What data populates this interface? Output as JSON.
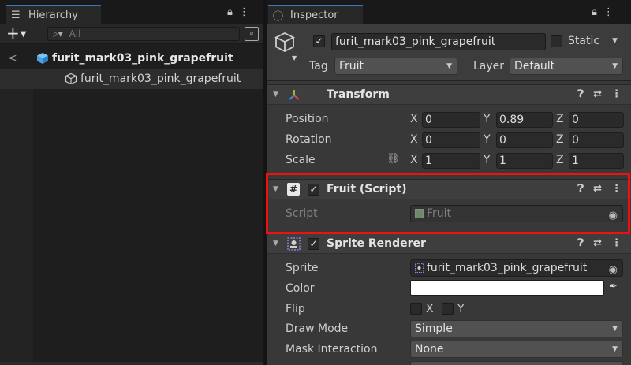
{
  "hierarchy": {
    "tab_label": "Hierarchy",
    "search_placeholder": "All",
    "scene_name": "furit_mark03_pink_grapefruit",
    "child_name": "furit_mark03_pink_grapefruit"
  },
  "inspector": {
    "tab_label": "Inspector",
    "object_name": "furit_mark03_pink_grapefruit",
    "active": true,
    "static_label": "Static",
    "tag_label": "Tag",
    "tag_value": "Fruit",
    "layer_label": "Layer",
    "layer_value": "Default",
    "transform": {
      "title": "Transform",
      "position_label": "Position",
      "rotation_label": "Rotation",
      "scale_label": "Scale",
      "position": {
        "x": "0",
        "y": "0.89",
        "z": "0"
      },
      "rotation": {
        "x": "0",
        "y": "0",
        "z": "0"
      },
      "scale": {
        "x": "1",
        "y": "1",
        "z": "1"
      }
    },
    "fruit_script": {
      "title": "Fruit (Script)",
      "enabled": true,
      "script_label": "Script",
      "script_value": "Fruit"
    },
    "sprite_renderer": {
      "title": "Sprite Renderer",
      "enabled": true,
      "sprite_label": "Sprite",
      "sprite_value": "furit_mark03_pink_grapefruit",
      "color_label": "Color",
      "color_value": "#FFFFFF",
      "flip_label": "Flip",
      "flip_x_label": "X",
      "flip_y_label": "Y",
      "draw_mode_label": "Draw Mode",
      "draw_mode_value": "Simple",
      "mask_label": "Mask Interaction",
      "mask_value": "None"
    }
  },
  "axis_labels": {
    "x": "X",
    "y": "Y",
    "z": "Z"
  },
  "colors": {
    "accent_tab": "#3A79BB",
    "highlight_box": "#EE1111",
    "cube_blue": "#4BA3E3"
  }
}
